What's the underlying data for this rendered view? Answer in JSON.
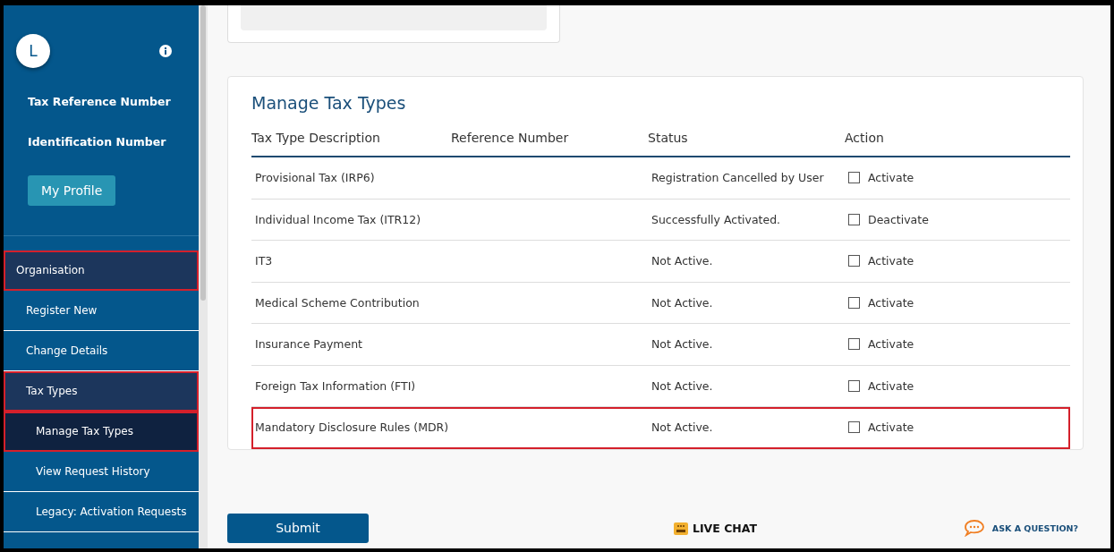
{
  "sidebar": {
    "avatar": "L",
    "fields": [
      "Tax Reference Number",
      "Identification Number"
    ],
    "profile_button": "My Profile",
    "nav": [
      {
        "label": "Organisation",
        "highlighted": true,
        "expanded": true,
        "selected": false,
        "children": [
          {
            "label": "Register New",
            "highlighted": false,
            "expanded": false,
            "selected": false
          },
          {
            "label": "Change Details",
            "highlighted": false,
            "expanded": false,
            "selected": false
          },
          {
            "label": "Tax Types",
            "highlighted": true,
            "expanded": true,
            "selected": false,
            "children": [
              {
                "label": "Manage Tax Types",
                "highlighted": true,
                "expanded": false,
                "selected": true
              },
              {
                "label": "View Request History",
                "highlighted": false,
                "expanded": false,
                "selected": false
              },
              {
                "label": "Legacy: Activation Requests",
                "highlighted": false,
                "expanded": false,
                "selected": false
              }
            ]
          }
        ]
      }
    ]
  },
  "card": {
    "title": "Manage Tax Types",
    "columns": [
      "Tax Type Description",
      "Reference Number",
      "Status",
      "Action"
    ],
    "rows": [
      {
        "description": "Provisional Tax (IRP6)",
        "status": "Registration Cancelled by User",
        "action": "Activate",
        "checked": false,
        "highlighted": false
      },
      {
        "description": "Individual Income Tax (ITR12)",
        "status": "Successfully Activated.",
        "action": "Deactivate",
        "checked": false,
        "highlighted": false
      },
      {
        "description": "IT3",
        "status": "Not Active.",
        "action": "Activate",
        "checked": false,
        "highlighted": false
      },
      {
        "description": "Medical Scheme Contribution",
        "status": "Not Active.",
        "action": "Activate",
        "checked": false,
        "highlighted": false
      },
      {
        "description": "Insurance Payment",
        "status": "Not Active.",
        "action": "Activate",
        "checked": false,
        "highlighted": false
      },
      {
        "description": "Foreign Tax Information (FTI)",
        "status": "Not Active.",
        "action": "Activate",
        "checked": false,
        "highlighted": false
      },
      {
        "description": "Mandatory Disclosure Rules (MDR)",
        "status": "Not Active.",
        "action": "Activate",
        "checked": false,
        "highlighted": true
      }
    ]
  },
  "footer": {
    "submit": "Submit",
    "live_chat": "LIVE CHAT",
    "ask": "ASK A QUESTION?"
  }
}
